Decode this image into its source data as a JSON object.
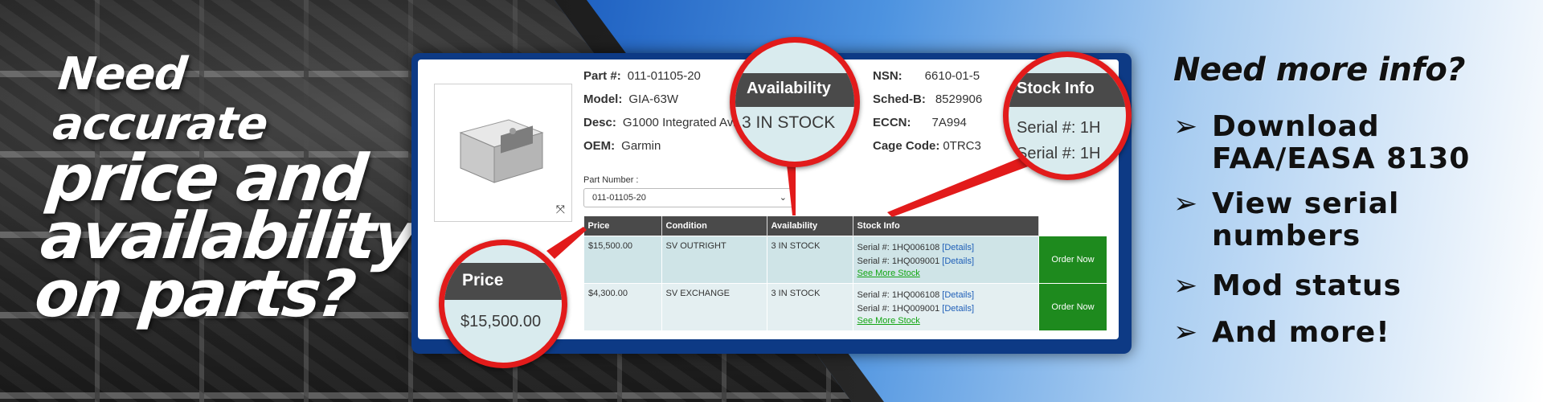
{
  "headline": {
    "line1": "Need accurate",
    "line2": "price and",
    "line3": "availability",
    "line4": "on parts?"
  },
  "product": {
    "image_icon": "avionics-unit-image",
    "expand_icon": "expand-arrows-icon",
    "fields": {
      "part_label": "Part #:",
      "part_value": "011-01105-20",
      "model_label": "Model:",
      "model_value": "GIA-63W",
      "desc_label": "Desc:",
      "desc_value": "G1000 Integrated Avio",
      "oem_label": "OEM:",
      "oem_value": "Garmin",
      "nsn_label": "NSN:",
      "nsn_value": "6610-01-5",
      "schedb_label": "Sched-B:",
      "schedb_value": "8529906",
      "eccn_label": "ECCN:",
      "eccn_value": "7A994",
      "cage_label": "Cage Code:",
      "cage_value": "0TRC3"
    },
    "part_number_label": "Part Number :",
    "part_number_selected": "011-01105-20"
  },
  "table": {
    "headers": [
      "Price",
      "Condition",
      "Availability",
      "Stock Info"
    ],
    "rows": [
      {
        "price": "$15,500.00",
        "condition": "SV OUTRIGHT",
        "availability": "3 IN STOCK",
        "serial1_label": "Serial #: 1HQ006108",
        "serial1_link": "[Details]",
        "serial2_label": "Serial #: 1HQ009001",
        "serial2_link": "[Details]",
        "more": "See More Stock",
        "order": "Order Now"
      },
      {
        "price": "$4,300.00",
        "condition": "SV EXCHANGE",
        "availability": "3 IN STOCK",
        "serial1_label": "Serial #: 1HQ006108",
        "serial1_link": "[Details]",
        "serial2_label": "Serial #: 1HQ009001",
        "serial2_link": "[Details]",
        "more": "See More Stock",
        "order": "Order Now"
      }
    ]
  },
  "magnifiers": {
    "availability": {
      "head": "Availability",
      "body": "3 IN STOCK"
    },
    "stock": {
      "head": "Stock Info",
      "line1": "Serial #: 1H",
      "line2": "Serial #: 1H"
    },
    "price": {
      "head": "Price",
      "body": "$15,500.00"
    }
  },
  "right": {
    "title": "Need more info?",
    "arrow": "➢",
    "items": [
      {
        "line1": "Download",
        "line2": "FAA/EASA 8130"
      },
      {
        "line1": "View serial",
        "line2": "numbers"
      },
      {
        "line1": "Mod status"
      },
      {
        "line1": "And more!"
      }
    ]
  },
  "colors": {
    "accent_red": "#e21b1b",
    "order_green": "#1e8a1e",
    "link_blue": "#1f5fb8",
    "more_green": "#13a513",
    "header_gray": "#4a4a4a"
  }
}
